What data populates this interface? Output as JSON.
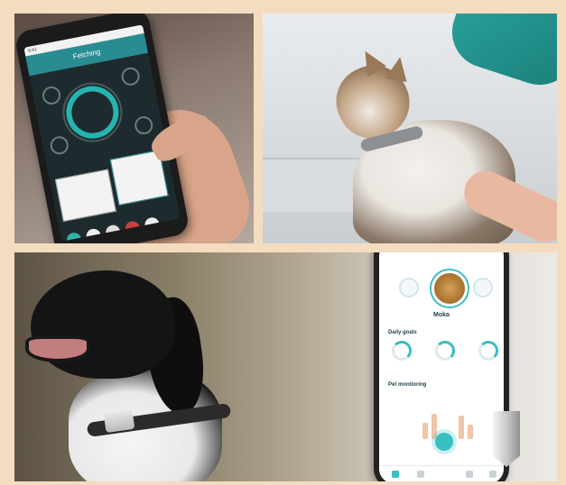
{
  "panel_top_left": {
    "app_header": "Fetching",
    "status_time": "9:41",
    "card_left": "",
    "card_right": ""
  },
  "panel_bottom_right_app": {
    "pet_name": "Moka",
    "pet_subtitle": "",
    "section_goals": "Daily goals",
    "goals": [
      {
        "label": "",
        "color": "#38bfc2"
      },
      {
        "label": "",
        "color": "#38bfc2"
      },
      {
        "label": "",
        "color": "#38bfc2"
      }
    ],
    "section_monitoring": "Pet monitoring",
    "accent_color": "#38bfc2"
  },
  "colors": {
    "page_background": "#f4dcc0",
    "teal_accent": "#2aa39d",
    "app_accent": "#38bfc2"
  }
}
